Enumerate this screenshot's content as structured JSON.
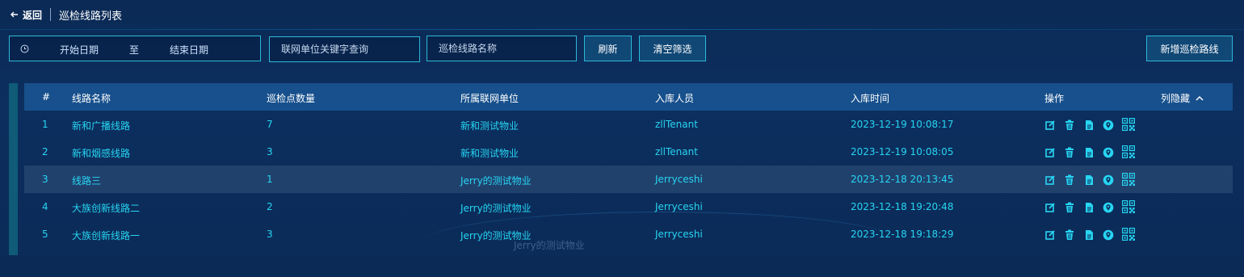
{
  "header": {
    "back_label": "返回",
    "title": "巡检线路列表"
  },
  "filters": {
    "date_start_placeholder": "开始日期",
    "date_separator": "至",
    "date_end_placeholder": "结束日期",
    "keyword_placeholder": "联网单位关键字查询",
    "route_name_placeholder": "巡检线路名称",
    "refresh_label": "刷新",
    "clear_label": "清空筛选",
    "add_label": "新增巡检路线"
  },
  "table": {
    "columns": [
      "#",
      "线路名称",
      "巡检点数量",
      "所属联网单位",
      "入库人员",
      "入库时间",
      "操作"
    ],
    "hide_columns_label": "列隐藏",
    "rows": [
      {
        "idx": "1",
        "name": "新和广播线路",
        "count": "7",
        "unit": "新和测试物业",
        "user": "zllTenant",
        "time": "2023-12-19 10:08:17"
      },
      {
        "idx": "2",
        "name": "新和烟感线路",
        "count": "3",
        "unit": "新和测试物业",
        "user": "zllTenant",
        "time": "2023-12-19 10:08:05"
      },
      {
        "idx": "3",
        "name": "线路三",
        "count": "1",
        "unit": "Jerry的测试物业",
        "user": "Jerryceshi",
        "time": "2023-12-18 20:13:45"
      },
      {
        "idx": "4",
        "name": "大族创新线路二",
        "count": "2",
        "unit": "Jerry的测试物业",
        "user": "Jerryceshi",
        "time": "2023-12-18 19:20:48"
      },
      {
        "idx": "5",
        "name": "大族创新线路一",
        "count": "3",
        "unit": "Jerry的测试物业",
        "user": "Jerryceshi",
        "time": "2023-12-18 19:18:29"
      }
    ]
  },
  "background_text": "Jerry的测试物业",
  "colors": {
    "accent": "#27d5f2",
    "border": "#2bb8d8",
    "header_bg": "#17508c"
  }
}
